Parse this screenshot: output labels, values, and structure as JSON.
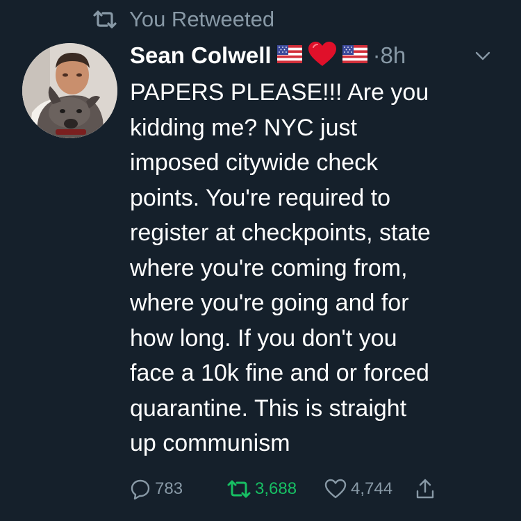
{
  "retweet_context": {
    "label": "You Retweeted",
    "icon": "retweet-icon"
  },
  "tweet": {
    "author": {
      "display_name": "Sean Colwell",
      "emoji_icons": [
        "us-flag-icon",
        "red-heart-icon",
        "us-flag-icon"
      ],
      "avatar_icon": "avatar"
    },
    "timestamp": "·8h",
    "text": "PAPERS PLEASE!!! Are you\nkidding me? NYC just\nimposed citywide check\npoints. You're required to\nregister at checkpoints, state\nwhere you're coming from,\nwhere you're going and for\nhow long. If you don't you\nface a 10k fine and or forced\nquarantine. This is straight\nup communism",
    "stats": {
      "replies": "783",
      "retweets": "3,688",
      "likes": "4,744"
    }
  },
  "colors": {
    "background": "#15202b",
    "secondary_text": "#8899a6",
    "retweeted_green": "#17bf63",
    "primary_text": "#ffffff"
  }
}
